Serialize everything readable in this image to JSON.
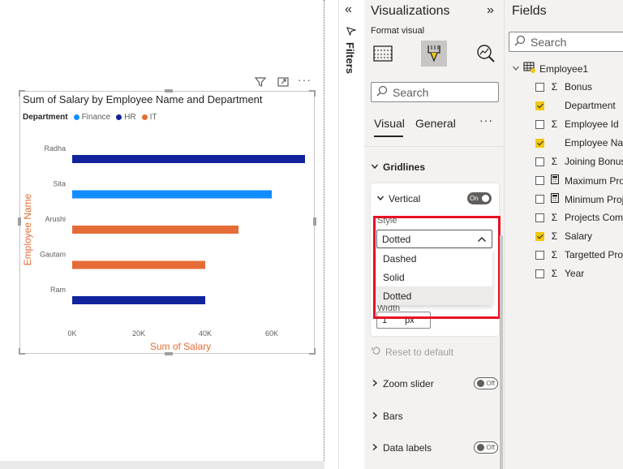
{
  "chart": {
    "title": "Sum of Salary by Employee Name and Department",
    "legend_title": "Department",
    "legend": [
      {
        "name": "Finance",
        "color": "#118dff"
      },
      {
        "name": "HR",
        "color": "#12239e"
      },
      {
        "name": "IT",
        "color": "#e66c37"
      }
    ],
    "xlabel": "Sum of Salary",
    "ylabel": "Employee Name",
    "header_icons": [
      "filter-icon",
      "focus-mode-icon",
      "more-options-icon"
    ]
  },
  "chart_data": {
    "type": "bar",
    "orientation": "horizontal",
    "categories": [
      "Radha",
      "Sita",
      "Arushi",
      "Gautam",
      "Ram"
    ],
    "values": [
      70000,
      60000,
      50000,
      40000,
      40000
    ],
    "category_department": [
      "HR",
      "Finance",
      "IT",
      "IT",
      "HR"
    ],
    "xlim": [
      0,
      70000
    ],
    "xticks": [
      "0K",
      "20K",
      "40K",
      "60K"
    ],
    "title": "Sum of Salary by Employee Name and Department",
    "xlabel": "Sum of Salary",
    "ylabel": "Employee Name",
    "legend_placement": "top-left"
  },
  "filters": {
    "label": "Filters"
  },
  "viz": {
    "title": "Visualizations",
    "format_label": "Format visual",
    "search_placeholder": "Search",
    "tabs": {
      "visual": "Visual",
      "general": "General",
      "more": "···"
    },
    "gridlines_label": "Gridlines",
    "vertical_label": "Vertical",
    "vertical_toggle": "On",
    "style_label": "Style",
    "style_value": "Dotted",
    "style_options": [
      "Dashed",
      "Solid",
      "Dotted"
    ],
    "width_label": "Width",
    "width_value": "1",
    "width_unit": "px",
    "reset_label": "Reset to default",
    "zoom_label": "Zoom slider",
    "zoom_toggle": "Off",
    "bars_label": "Bars",
    "datalabels_label": "Data labels",
    "datalabels_toggle": "Off"
  },
  "fields": {
    "title": "Fields",
    "search_placeholder": "Search",
    "table_name": "Employee1",
    "items": [
      {
        "name": "Bonus",
        "checked": false,
        "type": "sigma"
      },
      {
        "name": "Department",
        "checked": true,
        "type": "none"
      },
      {
        "name": "Employee Id",
        "checked": false,
        "type": "sigma"
      },
      {
        "name": "Employee Name",
        "checked": true,
        "type": "none"
      },
      {
        "name": "Joining Bonus",
        "checked": false,
        "type": "sigma"
      },
      {
        "name": "Maximum Projects",
        "checked": false,
        "type": "calc"
      },
      {
        "name": "Minimum Projects",
        "checked": false,
        "type": "calc"
      },
      {
        "name": "Projects Completed",
        "checked": false,
        "type": "sigma"
      },
      {
        "name": "Salary",
        "checked": true,
        "type": "sigma"
      },
      {
        "name": "Targetted Projects",
        "checked": false,
        "type": "sigma"
      },
      {
        "name": "Year",
        "checked": false,
        "type": "sigma"
      }
    ]
  }
}
